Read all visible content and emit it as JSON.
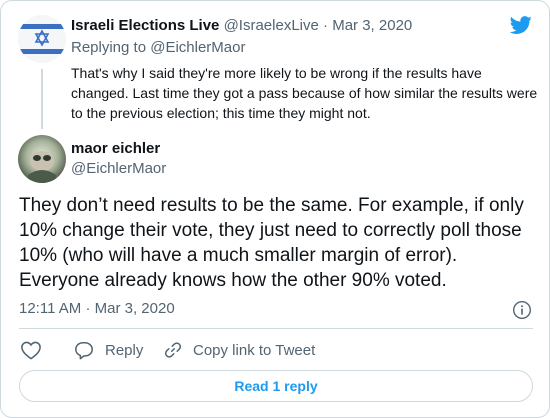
{
  "reply_tweet": {
    "author_name": "Israeli Elections Live",
    "author_handle": "@IsraelexLive",
    "separator": "·",
    "date": "Mar 3, 2020",
    "replying_prefix": "Replying to",
    "replying_handle": "@EichlerMaor",
    "text": "That's why I said they're more likely to be wrong if the results have changed. Last time they got a pass because of how similar the results were to the previous election; this time they might not."
  },
  "main_tweet": {
    "author_name": "maor eichler",
    "author_handle": "@EichlerMaor",
    "text": "They don’t need results to be the same. For example, if only 10% change their vote, they just need to correctly poll those 10% (who will have a much smaller margin of error). Everyone already knows how the other 90% voted.",
    "time": "12:11 AM",
    "separator": "·",
    "date": "Mar 3, 2020"
  },
  "actions": {
    "reply_label": "Reply",
    "copy_link_label": "Copy link to Tweet",
    "read_replies_label": "Read 1 reply"
  },
  "icons": {
    "brand": "twitter-bird-icon",
    "like": "heart-icon",
    "reply": "speech-bubble-icon",
    "copy": "link-icon",
    "info": "info-icon"
  },
  "colors": {
    "accent": "#1d9bf0",
    "text": "#0f1419",
    "muted": "#536471",
    "border": "#cfd9de"
  }
}
